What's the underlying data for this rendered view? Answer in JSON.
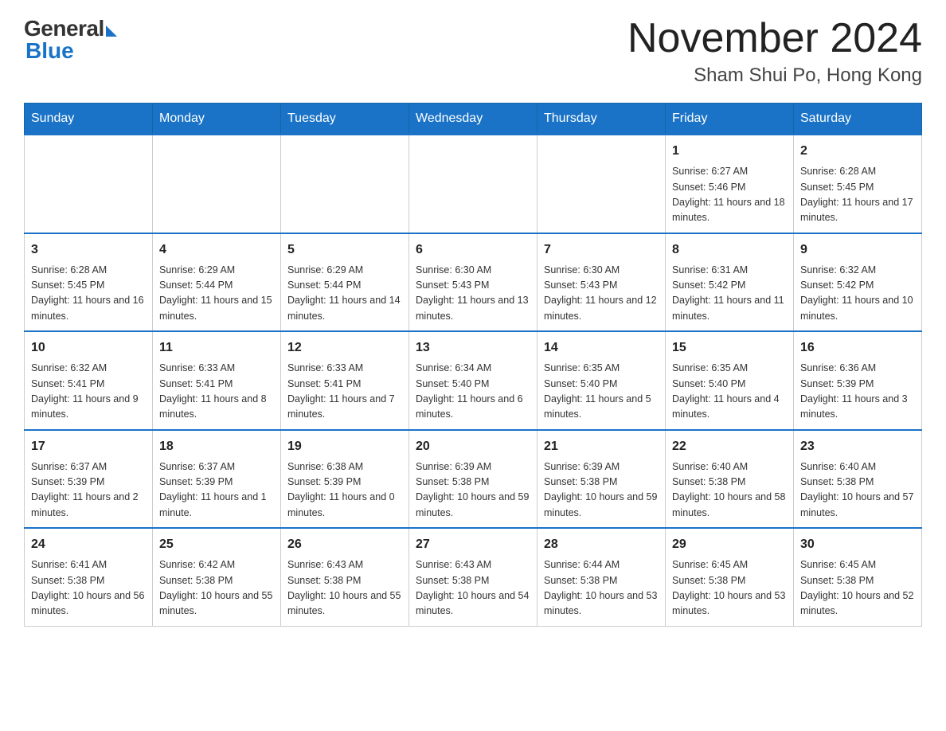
{
  "header": {
    "logo_general": "General",
    "logo_blue": "Blue",
    "month_title": "November 2024",
    "location": "Sham Shui Po, Hong Kong"
  },
  "weekdays": [
    "Sunday",
    "Monday",
    "Tuesday",
    "Wednesday",
    "Thursday",
    "Friday",
    "Saturday"
  ],
  "weeks": [
    [
      {
        "day": "",
        "info": ""
      },
      {
        "day": "",
        "info": ""
      },
      {
        "day": "",
        "info": ""
      },
      {
        "day": "",
        "info": ""
      },
      {
        "day": "",
        "info": ""
      },
      {
        "day": "1",
        "info": "Sunrise: 6:27 AM\nSunset: 5:46 PM\nDaylight: 11 hours and 18 minutes."
      },
      {
        "day": "2",
        "info": "Sunrise: 6:28 AM\nSunset: 5:45 PM\nDaylight: 11 hours and 17 minutes."
      }
    ],
    [
      {
        "day": "3",
        "info": "Sunrise: 6:28 AM\nSunset: 5:45 PM\nDaylight: 11 hours and 16 minutes."
      },
      {
        "day": "4",
        "info": "Sunrise: 6:29 AM\nSunset: 5:44 PM\nDaylight: 11 hours and 15 minutes."
      },
      {
        "day": "5",
        "info": "Sunrise: 6:29 AM\nSunset: 5:44 PM\nDaylight: 11 hours and 14 minutes."
      },
      {
        "day": "6",
        "info": "Sunrise: 6:30 AM\nSunset: 5:43 PM\nDaylight: 11 hours and 13 minutes."
      },
      {
        "day": "7",
        "info": "Sunrise: 6:30 AM\nSunset: 5:43 PM\nDaylight: 11 hours and 12 minutes."
      },
      {
        "day": "8",
        "info": "Sunrise: 6:31 AM\nSunset: 5:42 PM\nDaylight: 11 hours and 11 minutes."
      },
      {
        "day": "9",
        "info": "Sunrise: 6:32 AM\nSunset: 5:42 PM\nDaylight: 11 hours and 10 minutes."
      }
    ],
    [
      {
        "day": "10",
        "info": "Sunrise: 6:32 AM\nSunset: 5:41 PM\nDaylight: 11 hours and 9 minutes."
      },
      {
        "day": "11",
        "info": "Sunrise: 6:33 AM\nSunset: 5:41 PM\nDaylight: 11 hours and 8 minutes."
      },
      {
        "day": "12",
        "info": "Sunrise: 6:33 AM\nSunset: 5:41 PM\nDaylight: 11 hours and 7 minutes."
      },
      {
        "day": "13",
        "info": "Sunrise: 6:34 AM\nSunset: 5:40 PM\nDaylight: 11 hours and 6 minutes."
      },
      {
        "day": "14",
        "info": "Sunrise: 6:35 AM\nSunset: 5:40 PM\nDaylight: 11 hours and 5 minutes."
      },
      {
        "day": "15",
        "info": "Sunrise: 6:35 AM\nSunset: 5:40 PM\nDaylight: 11 hours and 4 minutes."
      },
      {
        "day": "16",
        "info": "Sunrise: 6:36 AM\nSunset: 5:39 PM\nDaylight: 11 hours and 3 minutes."
      }
    ],
    [
      {
        "day": "17",
        "info": "Sunrise: 6:37 AM\nSunset: 5:39 PM\nDaylight: 11 hours and 2 minutes."
      },
      {
        "day": "18",
        "info": "Sunrise: 6:37 AM\nSunset: 5:39 PM\nDaylight: 11 hours and 1 minute."
      },
      {
        "day": "19",
        "info": "Sunrise: 6:38 AM\nSunset: 5:39 PM\nDaylight: 11 hours and 0 minutes."
      },
      {
        "day": "20",
        "info": "Sunrise: 6:39 AM\nSunset: 5:38 PM\nDaylight: 10 hours and 59 minutes."
      },
      {
        "day": "21",
        "info": "Sunrise: 6:39 AM\nSunset: 5:38 PM\nDaylight: 10 hours and 59 minutes."
      },
      {
        "day": "22",
        "info": "Sunrise: 6:40 AM\nSunset: 5:38 PM\nDaylight: 10 hours and 58 minutes."
      },
      {
        "day": "23",
        "info": "Sunrise: 6:40 AM\nSunset: 5:38 PM\nDaylight: 10 hours and 57 minutes."
      }
    ],
    [
      {
        "day": "24",
        "info": "Sunrise: 6:41 AM\nSunset: 5:38 PM\nDaylight: 10 hours and 56 minutes."
      },
      {
        "day": "25",
        "info": "Sunrise: 6:42 AM\nSunset: 5:38 PM\nDaylight: 10 hours and 55 minutes."
      },
      {
        "day": "26",
        "info": "Sunrise: 6:43 AM\nSunset: 5:38 PM\nDaylight: 10 hours and 55 minutes."
      },
      {
        "day": "27",
        "info": "Sunrise: 6:43 AM\nSunset: 5:38 PM\nDaylight: 10 hours and 54 minutes."
      },
      {
        "day": "28",
        "info": "Sunrise: 6:44 AM\nSunset: 5:38 PM\nDaylight: 10 hours and 53 minutes."
      },
      {
        "day": "29",
        "info": "Sunrise: 6:45 AM\nSunset: 5:38 PM\nDaylight: 10 hours and 53 minutes."
      },
      {
        "day": "30",
        "info": "Sunrise: 6:45 AM\nSunset: 5:38 PM\nDaylight: 10 hours and 52 minutes."
      }
    ]
  ]
}
